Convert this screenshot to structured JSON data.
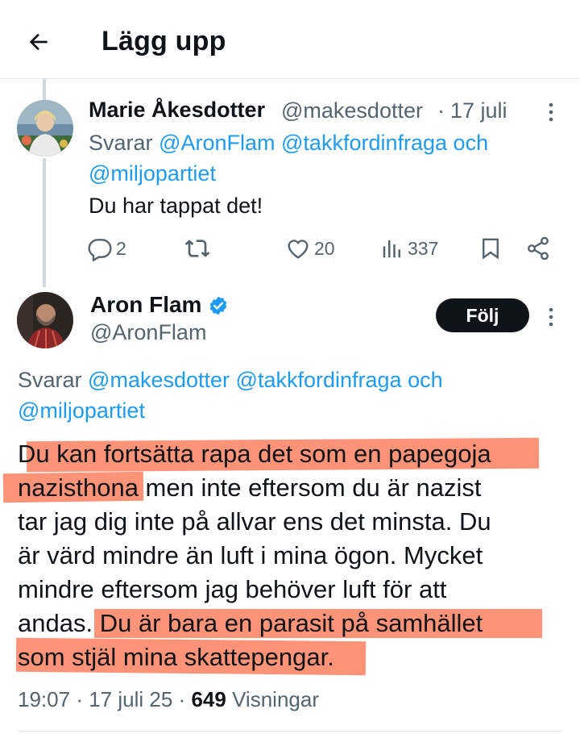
{
  "header": {
    "title": "Lägg upp",
    "back_icon": "arrow-left-icon"
  },
  "reply_tweet": {
    "author_name": "Marie Åkesdotter",
    "handle": "@makesdotter",
    "separator": "·",
    "date": "17 juli",
    "replying_prefix": "Svarar",
    "mention1": "@AronFlam",
    "mention2": "@takkfordinfraga",
    "conjunction": "och",
    "mention3": "@miljopartiet",
    "text": "Du har tappat det!",
    "replies": "2",
    "likes": "20",
    "views": "337"
  },
  "main_tweet": {
    "author_name": "Aron Flam",
    "handle": "@AronFlam",
    "follow_label": "Följ",
    "replying_prefix": "Svarar",
    "mention1": "@makesdotter",
    "mention2": "@takkfordinfraga",
    "conjunction": "och",
    "mention3": "@miljopartiet",
    "lines": [
      "Du kan fortsätta rapa det som en papegoja",
      "nazisthona men inte eftersom du är nazist",
      "tar jag dig inte på allvar ens det minsta. Du",
      "är värd mindre än luft i mina ögon. Mycket",
      "mindre eftersom jag behöver luft för att",
      "andas. Du är bara en parasit på samhället",
      "som stjäl mina skattepengar."
    ],
    "time": "19:07",
    "separator": "·",
    "date": "17 juli 25",
    "views_count": "649",
    "views_label": "Visningar"
  },
  "colors": {
    "accent": "#1d9bf0",
    "highlight": "#ff8a6b",
    "text": "#0f1419",
    "secondary": "#536471"
  }
}
